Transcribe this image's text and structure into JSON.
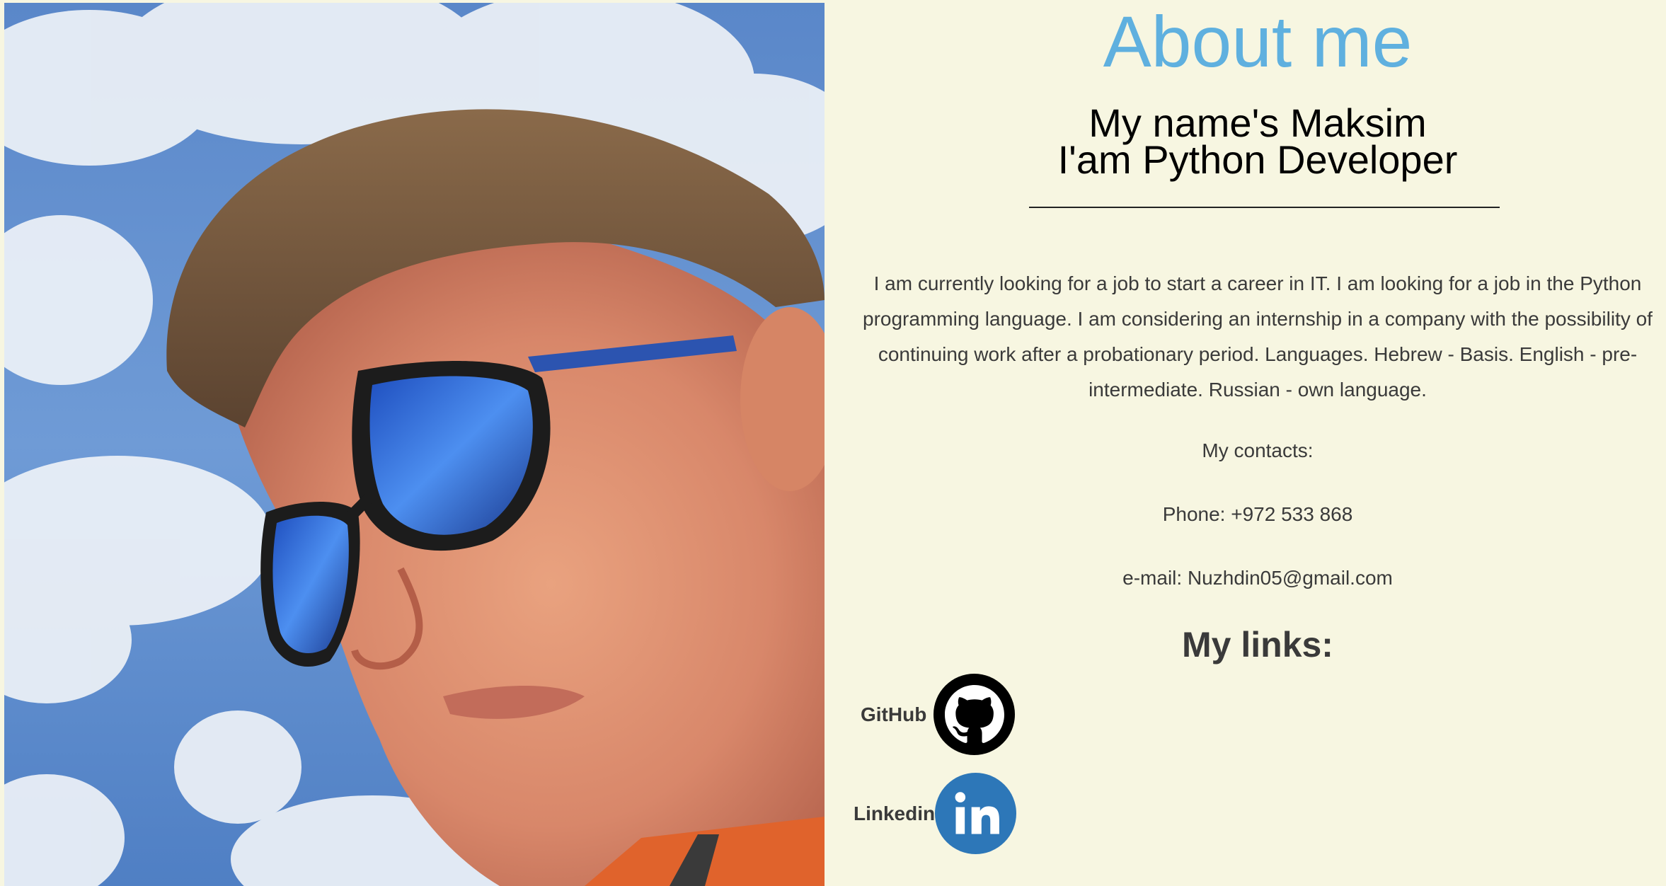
{
  "photo": {
    "alt": "Portrait photo of Maksim wearing blue mirrored sunglasses against a cloudy sky"
  },
  "header": {
    "title": "About me",
    "subtitle_line1": "My name's Maksim",
    "subtitle_line2": "I'am Python Developer"
  },
  "bio": {
    "text": "I am currently looking for a job to start a career in IT. I am looking for a job in the Python programming language. I am considering an internship in a company with the possibility of continuing work after a probationary period. Languages. Hebrew - Basis. English - pre-intermediate. Russian - own language."
  },
  "contacts": {
    "heading": "My contacts:",
    "phone": "Phone: +972 533 868",
    "email": "e-mail: Nuzhdin05@gmail.com"
  },
  "links": {
    "heading": "My links:",
    "items": [
      {
        "label": "GitHub",
        "icon": "github-icon",
        "color": "#000000"
      },
      {
        "label": "Linkedin",
        "icon": "linkedin-icon",
        "color": "#2d77b8"
      }
    ]
  },
  "colors": {
    "background": "#f7f6e1",
    "title": "#5fb0df",
    "text": "#3a3a3a"
  }
}
